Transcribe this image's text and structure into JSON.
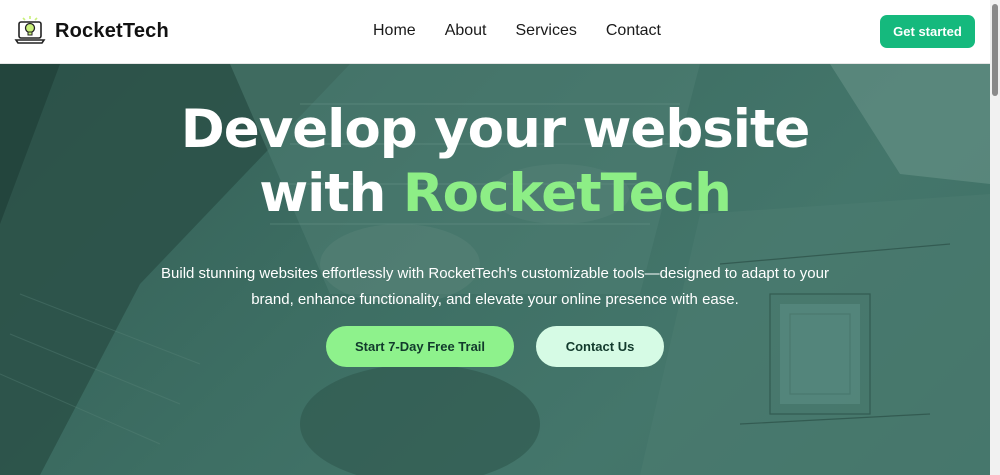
{
  "brand": {
    "name": "RocketTech",
    "logo_icon": "laptop-bulb-icon"
  },
  "nav": {
    "items": [
      "Home",
      "About",
      "Services",
      "Contact"
    ]
  },
  "header": {
    "cta_label": "Get started"
  },
  "hero": {
    "title_line1": "Develop your website",
    "title_line2_prefix": "with ",
    "title_line2_accent": "RocketTech",
    "subtitle": "Build stunning websites effortlessly with RocketTech's customizable tools—designed to adapt to your brand, enhance functionality, and elevate your online presence with ease.",
    "primary_button": "Start 7-Day Free Trail",
    "secondary_button": "Contact Us"
  },
  "colors": {
    "accent": "#15b97d",
    "highlight": "#8dee86",
    "hero_overlay": "#3d6e63",
    "primary_button": "#8ef28c",
    "secondary_button": "#d6fbe5"
  }
}
